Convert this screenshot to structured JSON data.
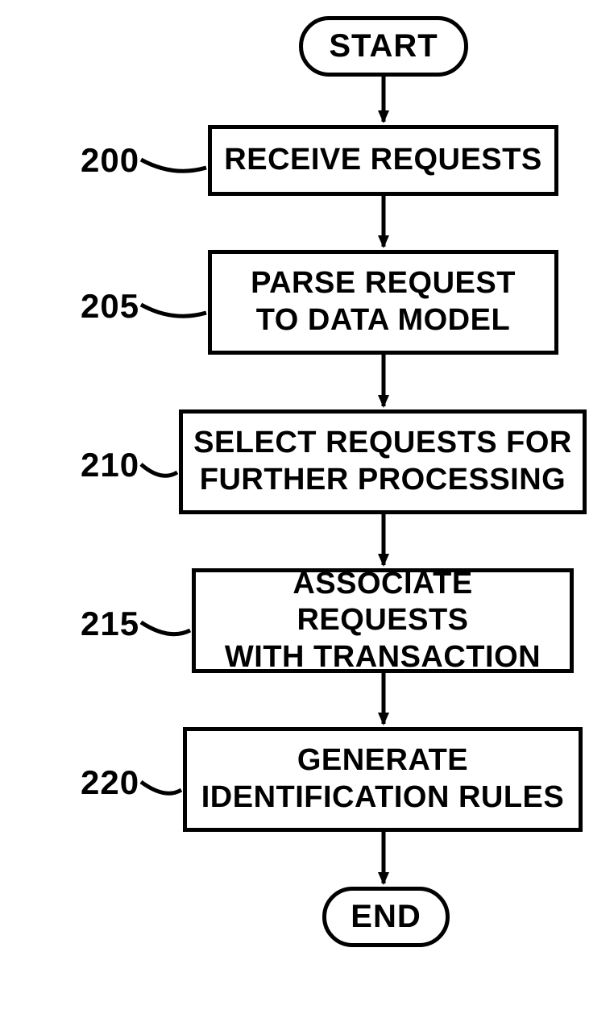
{
  "chart_data": {
    "type": "flowchart",
    "nodes": [
      {
        "id": "start",
        "shape": "terminator",
        "label": "START"
      },
      {
        "id": "n200",
        "shape": "process",
        "ref": "200",
        "label": "RECEIVE REQUESTS"
      },
      {
        "id": "n205",
        "shape": "process",
        "ref": "205",
        "label": "PARSE REQUEST\nTO DATA MODEL"
      },
      {
        "id": "n210",
        "shape": "process",
        "ref": "210",
        "label": "SELECT REQUESTS FOR\nFURTHER PROCESSING"
      },
      {
        "id": "n215",
        "shape": "process",
        "ref": "215",
        "label": "ASSOCIATE REQUESTS\nWITH TRANSACTION"
      },
      {
        "id": "n220",
        "shape": "process",
        "ref": "220",
        "label": "GENERATE\nIDENTIFICATION RULES"
      },
      {
        "id": "end",
        "shape": "terminator",
        "label": "END"
      }
    ],
    "edges": [
      [
        "start",
        "n200"
      ],
      [
        "n200",
        "n205"
      ],
      [
        "n205",
        "n210"
      ],
      [
        "n210",
        "n215"
      ],
      [
        "n215",
        "n220"
      ],
      [
        "n220",
        "end"
      ]
    ]
  },
  "terminators": {
    "start": "START",
    "end": "END"
  },
  "steps": {
    "s200": {
      "ref": "200",
      "text": "RECEIVE REQUESTS"
    },
    "s205": {
      "ref": "205",
      "line1": "PARSE REQUEST",
      "line2": "TO DATA MODEL"
    },
    "s210": {
      "ref": "210",
      "line1": "SELECT REQUESTS FOR",
      "line2": "FURTHER PROCESSING"
    },
    "s215": {
      "ref": "215",
      "line1": "ASSOCIATE REQUESTS",
      "line2": "WITH TRANSACTION"
    },
    "s220": {
      "ref": "220",
      "line1": "GENERATE",
      "line2": "IDENTIFICATION RULES"
    }
  }
}
